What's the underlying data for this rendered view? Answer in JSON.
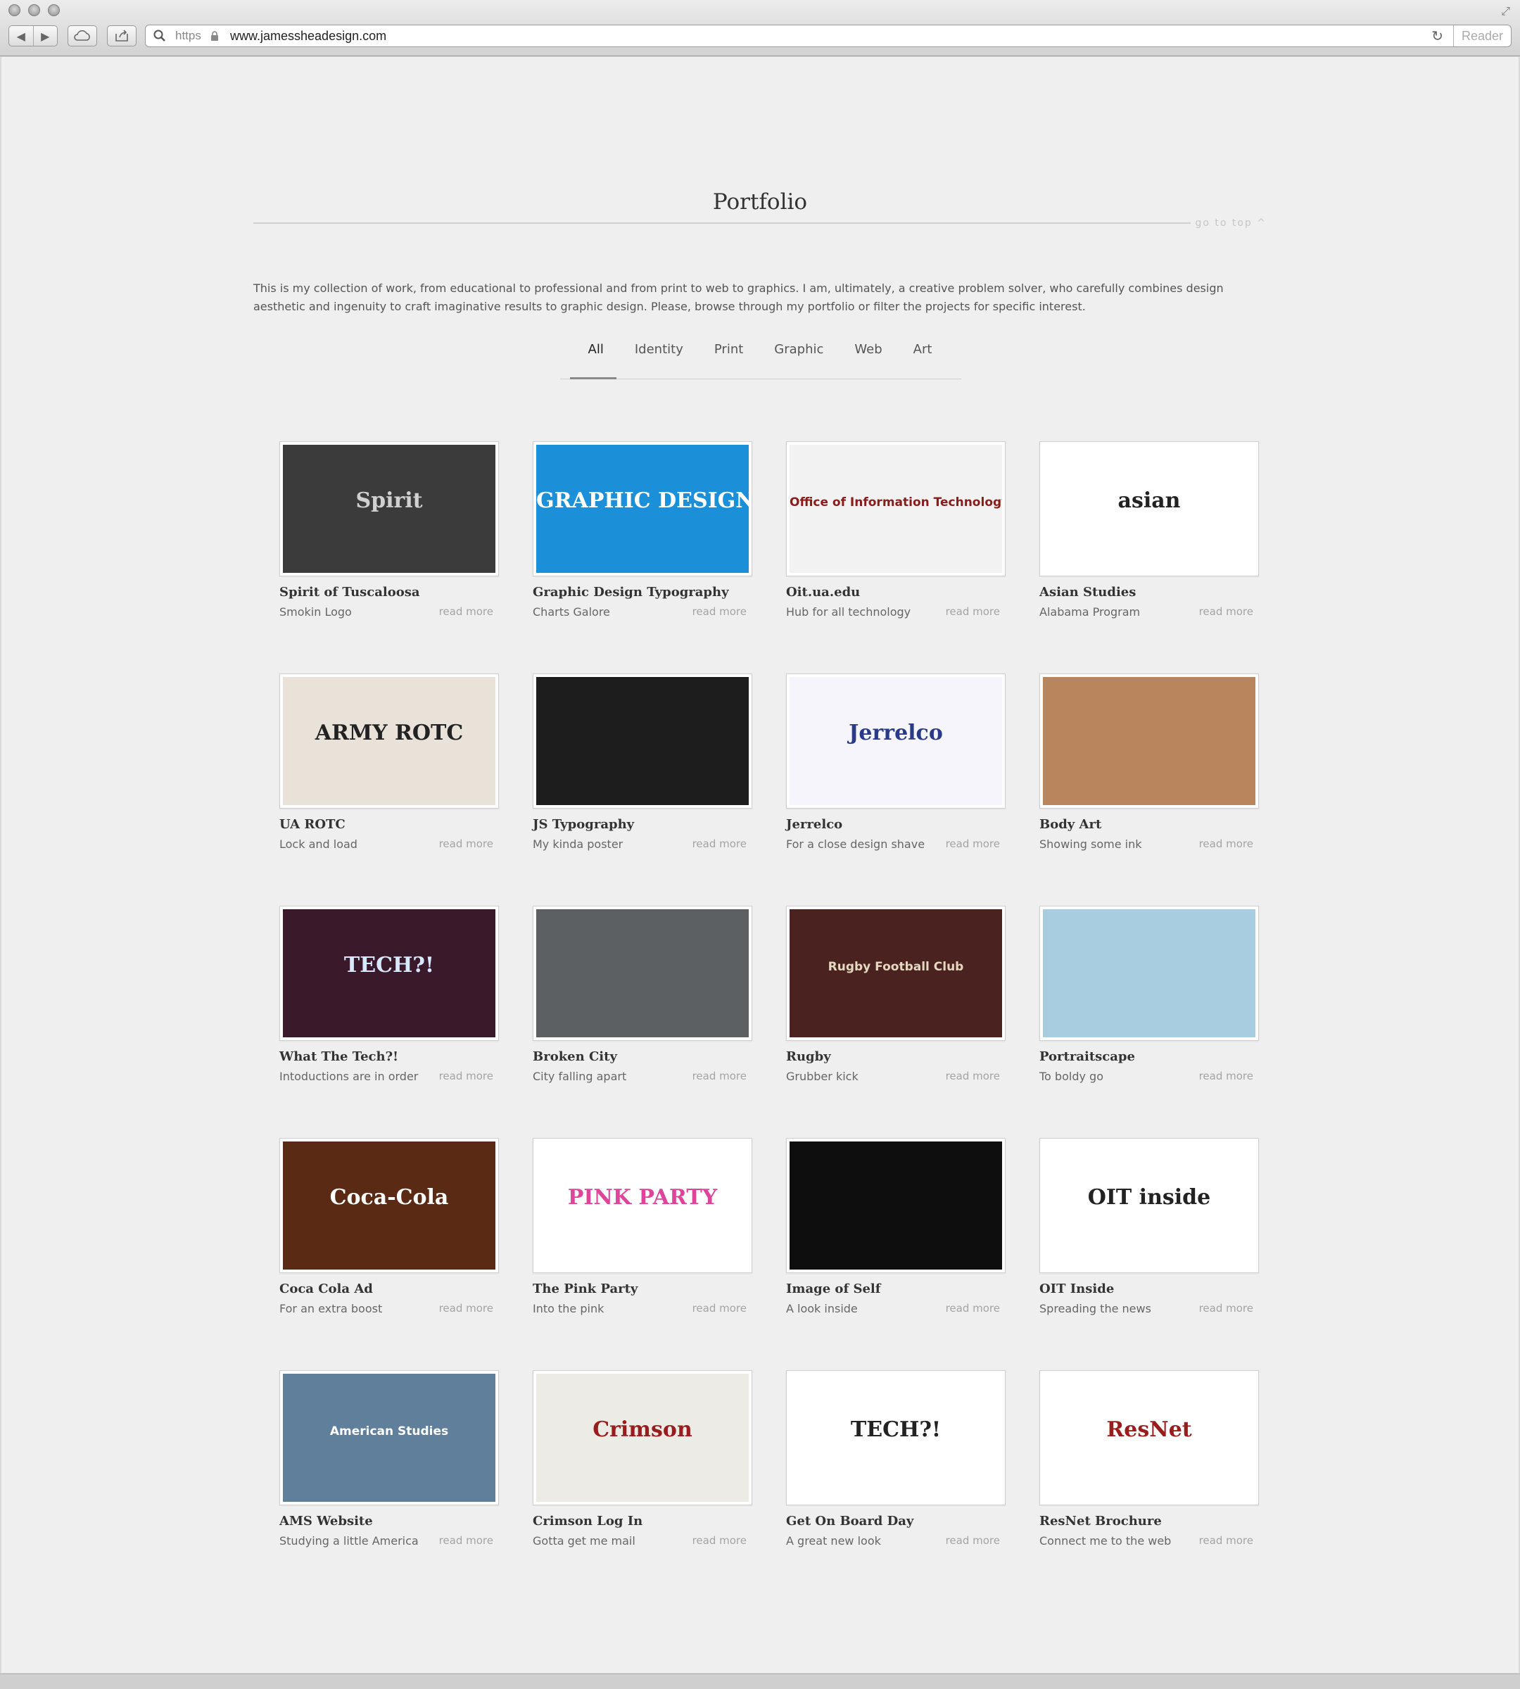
{
  "browser": {
    "url_scheme": "https",
    "url": "www.jamessheadesign.com",
    "reader_label": "Reader"
  },
  "page": {
    "title": "Portfolio",
    "go_to_top": "go to top",
    "intro": "This is my collection of work, from educational to professional and from print to web to graphics. I am, ultimately, a creative problem solver, who carefully combines design aesthetic and ingenuity to craft imaginative results to graphic design. Please, browse through my portfolio or filter the projects for specific interest.",
    "filters": [
      "All",
      "Identity",
      "Print",
      "Graphic",
      "Web",
      "Art"
    ],
    "active_filter": "All",
    "read_more_label": "read more"
  },
  "portfolio": [
    {
      "title": "Spirit of Tuscaloosa",
      "subtitle": "Smokin Logo",
      "art": "Spirit",
      "bg": "#3b3b3b",
      "fg": "#d0d0d0"
    },
    {
      "title": "Graphic Design Typography",
      "subtitle": "Charts Galore",
      "art": "GRAPHIC DESIGN",
      "bg": "#1b8fd8",
      "fg": "#ffffff"
    },
    {
      "title": "Oit.ua.edu",
      "subtitle": "Hub for all technology",
      "art": "Office of Information Technology",
      "bg": "#f2f2f2",
      "fg": "#8a1c1c"
    },
    {
      "title": "Asian Studies",
      "subtitle": "Alabama Program",
      "art": "asian",
      "bg": "#ffffff",
      "fg": "#222222"
    },
    {
      "title": "UA ROTC",
      "subtitle": "Lock and load",
      "art": "ARMY ROTC",
      "bg": "#e8e2d8",
      "fg": "#222222"
    },
    {
      "title": "JS Typography",
      "subtitle": "My kinda poster",
      "art": "",
      "bg": "#1d1d1d",
      "fg": "#444444"
    },
    {
      "title": "Jerrelco",
      "subtitle": "For a close design shave",
      "art": "Jerrelco",
      "bg": "#f5f5fb",
      "fg": "#2a3a8a"
    },
    {
      "title": "Body Art",
      "subtitle": "Showing some ink",
      "art": "",
      "bg": "#b9855d",
      "fg": "#3a2a20"
    },
    {
      "title": "What The Tech?!",
      "subtitle": "Intoductions are in order",
      "art": "TECH?!",
      "bg": "#3a1a2a",
      "fg": "#d8e8ff"
    },
    {
      "title": "Broken City",
      "subtitle": "City falling apart",
      "art": "",
      "bg": "#5c6063",
      "fg": "#1b1b1b"
    },
    {
      "title": "Rugby",
      "subtitle": "Grubber kick",
      "art": "Rugby Football Club",
      "bg": "#4a2220",
      "fg": "#e5d8c0"
    },
    {
      "title": "Portraitscape",
      "subtitle": "To boldy go",
      "art": "",
      "bg": "#a9cde0",
      "fg": "#3a4a5a"
    },
    {
      "title": "Coca Cola Ad",
      "subtitle": "For an extra boost",
      "art": "Coca-Cola",
      "bg": "#5a2a14",
      "fg": "#ffffff"
    },
    {
      "title": "The Pink Party",
      "subtitle": "Into the pink",
      "art": "PINK PARTY",
      "bg": "#ffffff",
      "fg": "#e0449a"
    },
    {
      "title": "Image of Self",
      "subtitle": "A look inside",
      "art": "",
      "bg": "#0e0e0e",
      "fg": "#9a9a9a"
    },
    {
      "title": "OIT Inside",
      "subtitle": "Spreading the news",
      "art": "OIT inside",
      "bg": "#ffffff",
      "fg": "#222222"
    },
    {
      "title": "AMS Website",
      "subtitle": "Studying a little America",
      "art": "American Studies",
      "bg": "#5f7f9a",
      "fg": "#ffffff"
    },
    {
      "title": "Crimson Log In",
      "subtitle": "Gotta get me mail",
      "art": "Crimson",
      "bg": "#ecebe6",
      "fg": "#9a1c1c"
    },
    {
      "title": "Get On Board Day",
      "subtitle": "A great new look",
      "art": "TECH?!",
      "bg": "#ffffff",
      "fg": "#222222"
    },
    {
      "title": "ResNet Brochure",
      "subtitle": "Connect me to the web",
      "art": "ResNet",
      "bg": "#ffffff",
      "fg": "#9a1c1c"
    }
  ]
}
